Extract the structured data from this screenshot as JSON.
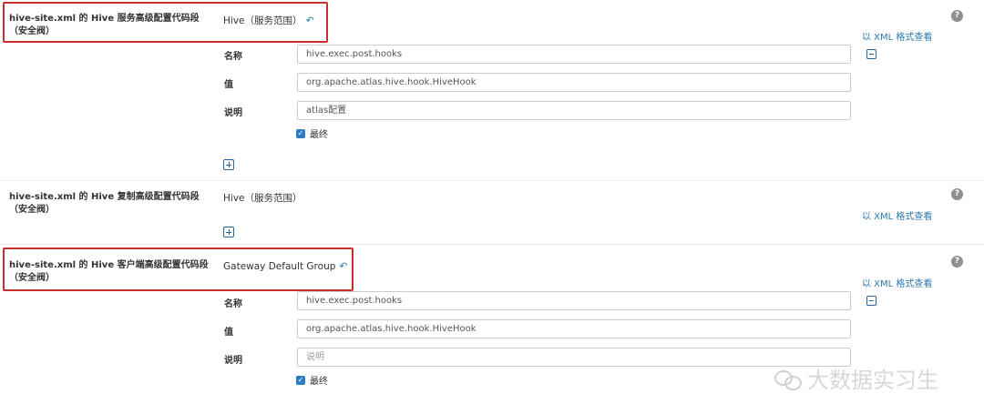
{
  "sections": [
    {
      "title": "hive-site.xml 的 Hive 服务高级配置代码段（安全阀）",
      "scope": "Hive（服务范围）",
      "xml_link": "以 XML 格式查看",
      "help": "?",
      "fields": {
        "name_label": "名称",
        "name_value": "hive.exec.post.hooks",
        "value_label": "值",
        "value_value": "org.apache.atlas.hive.hook.HiveHook",
        "desc_label": "说明",
        "desc_value": "atlas配置"
      },
      "final_label": "最终"
    },
    {
      "title": "hive-site.xml 的 Hive 复制高级配置代码段（安全阀）",
      "scope": "Hive（服务范围）",
      "xml_link": "以 XML 格式查看",
      "help": "?"
    },
    {
      "title": "hive-site.xml 的 Hive 客户端高级配置代码段（安全阀）",
      "scope": "Gateway Default Group",
      "xml_link": "以 XML 格式查看",
      "help": "?",
      "fields": {
        "name_label": "名称",
        "name_value": "hive.exec.post.hooks",
        "value_label": "值",
        "value_value": "org.apache.atlas.hive.hook.HiveHook",
        "desc_label": "说明",
        "desc_placeholder": "说明"
      },
      "final_label": "最终"
    }
  ],
  "icons": {
    "undo": "undo-arrow-icon",
    "remove": "minus-square-icon",
    "add": "plus-square-icon",
    "checkbox": "checkbox-checked-icon",
    "help": "help-circle-icon"
  },
  "colors": {
    "link": "#2a7ab0",
    "highlight_box": "#c9302c",
    "checkbox": "#2f7cc4"
  },
  "watermark": "大数据实习生"
}
